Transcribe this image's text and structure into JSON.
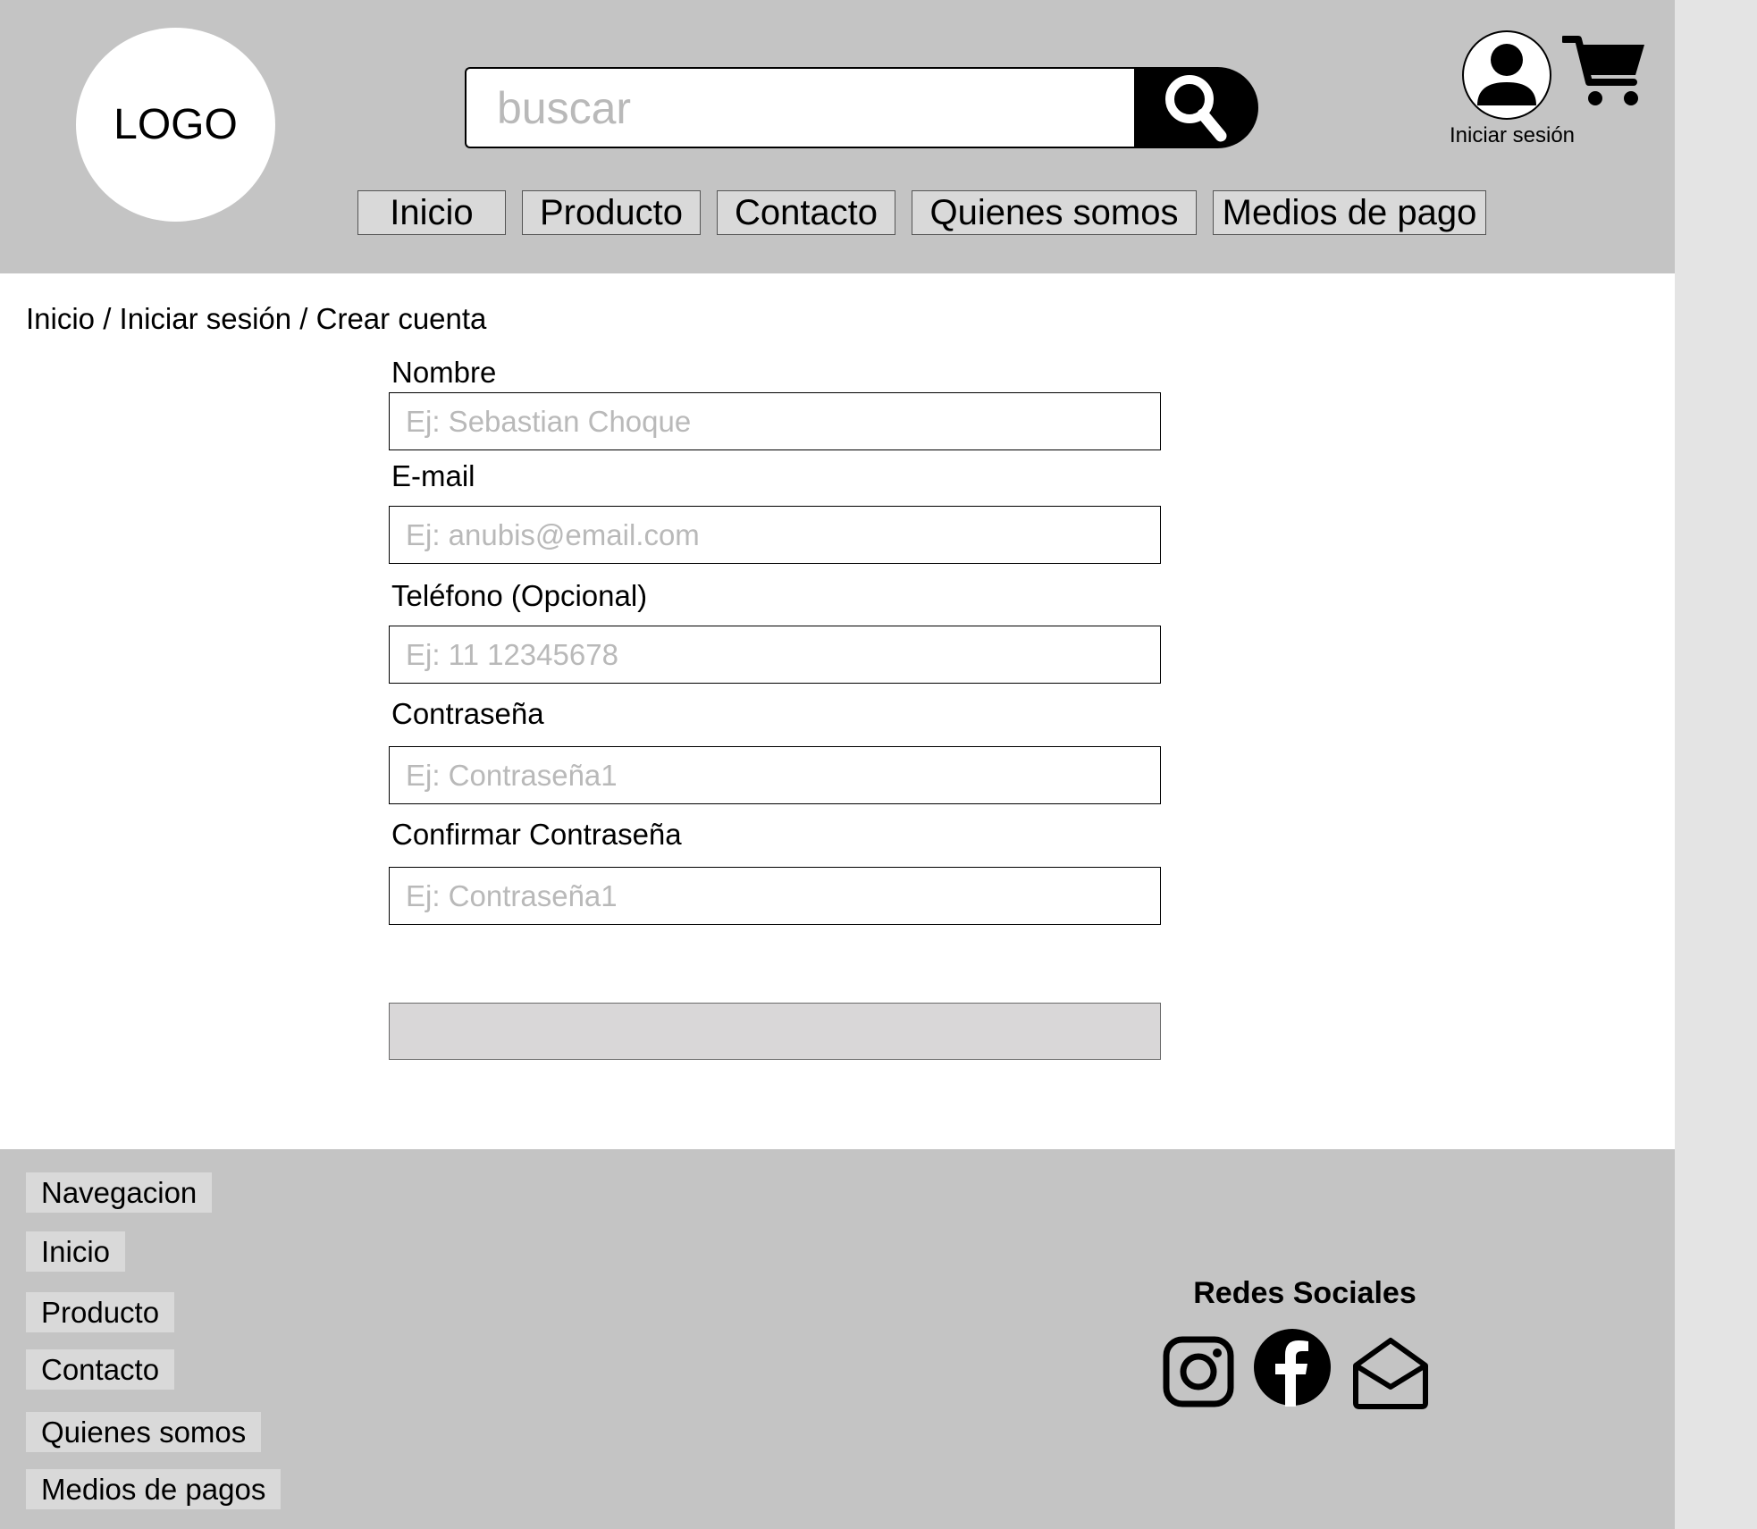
{
  "header": {
    "logo_text": "LOGO",
    "search": {
      "placeholder": "buscar",
      "icon": "search-icon"
    },
    "account": {
      "label": "Iniciar sesión",
      "icon": "user-icon"
    },
    "cart": {
      "icon": "cart-icon"
    },
    "nav": [
      "Inicio",
      "Producto",
      "Contacto",
      "Quienes somos",
      "Medios de pago"
    ]
  },
  "breadcrumb": "Inicio / Iniciar sesión / Crear cuenta",
  "form": {
    "fields": [
      {
        "label": "Nombre",
        "placeholder": "Ej: Sebastian Choque"
      },
      {
        "label": "E-mail",
        "placeholder": "Ej: anubis@email.com"
      },
      {
        "label": "Teléfono (Opcional)",
        "placeholder": "Ej: 11 12345678"
      },
      {
        "label": "Contraseña",
        "placeholder": "Ej: Contraseña1"
      },
      {
        "label": "Confirmar Contraseña",
        "placeholder": "Ej: Contraseña1"
      }
    ],
    "submit_label": ""
  },
  "footer": {
    "nav_title": "Navegacion",
    "nav_items": [
      "Inicio",
      "Producto",
      "Contacto",
      "Quienes somos",
      "Medios de pagos"
    ],
    "social_title": "Redes Sociales",
    "social_icons": [
      "instagram-icon",
      "facebook-icon",
      "email-icon"
    ]
  },
  "colors": {
    "header_bg": "#c4c4c4",
    "button_bg": "#d9d9d9",
    "placeholder": "#b9b9b9",
    "outer_bg": "#e4e4e4"
  }
}
